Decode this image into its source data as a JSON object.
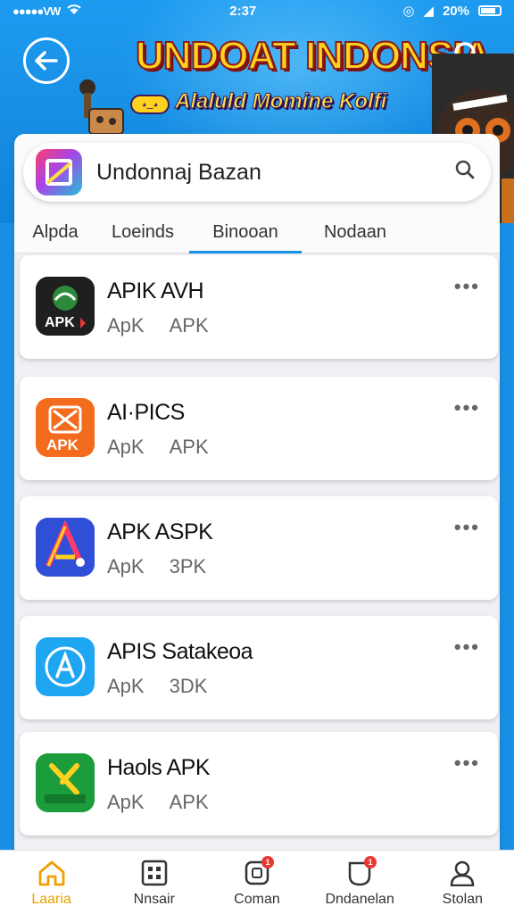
{
  "status_bar": {
    "carrier": "●●●●●VW",
    "time": "2:37",
    "battery": "20%"
  },
  "header": {
    "title": "UNDOAT INDONSIA",
    "subtitle": "Alaluld Momine Kolfi"
  },
  "search": {
    "value": "Undonnaj Bazan"
  },
  "tabs": [
    {
      "label": "Alpda",
      "active": false
    },
    {
      "label": "Loeinds",
      "active": false
    },
    {
      "label": "Binooan",
      "active": true
    },
    {
      "label": "Nodaan",
      "active": false
    }
  ],
  "apps": [
    {
      "name": "APIK AVH",
      "meta1": "ApK",
      "meta2": "APK",
      "icon": "apk-dark-icon",
      "icon_label": "APK",
      "color": "#1f1f1f"
    },
    {
      "name": "AI·PICS",
      "meta1": "ApK",
      "meta2": "APK",
      "icon": "apk-orange-icon",
      "icon_label": "APK",
      "color": "#f36b1c"
    },
    {
      "name": "APK ASPK",
      "meta1": "ApK",
      "meta2": "3PK",
      "icon": "apk-triangle-icon",
      "icon_label": "A",
      "color": "#2f4fd6"
    },
    {
      "name": "APIS Satakeoa",
      "meta1": "ApK",
      "meta2": "3DK",
      "icon": "app-store-icon",
      "icon_label": "A",
      "color": "#1ea6f2"
    },
    {
      "name": "Haols APK",
      "meta1": "ApK",
      "meta2": "APK",
      "icon": "apk-green-icon",
      "icon_label": "X",
      "color": "#1c9c3a"
    }
  ],
  "bottom_nav": [
    {
      "label": "Laaria",
      "icon": "home-icon",
      "active": true,
      "badge": ""
    },
    {
      "label": "Nnsair",
      "icon": "grid-icon",
      "active": false,
      "badge": ""
    },
    {
      "label": "Coman",
      "icon": "chat-icon",
      "active": false,
      "badge": "1"
    },
    {
      "label": "Dndanelan",
      "icon": "download-icon",
      "active": false,
      "badge": "1"
    },
    {
      "label": "Stolan",
      "icon": "profile-icon",
      "active": false,
      "badge": ""
    }
  ],
  "colors": {
    "accent": "#1a8fe6",
    "active_nav": "#f0a000",
    "badge": "#e53935"
  }
}
